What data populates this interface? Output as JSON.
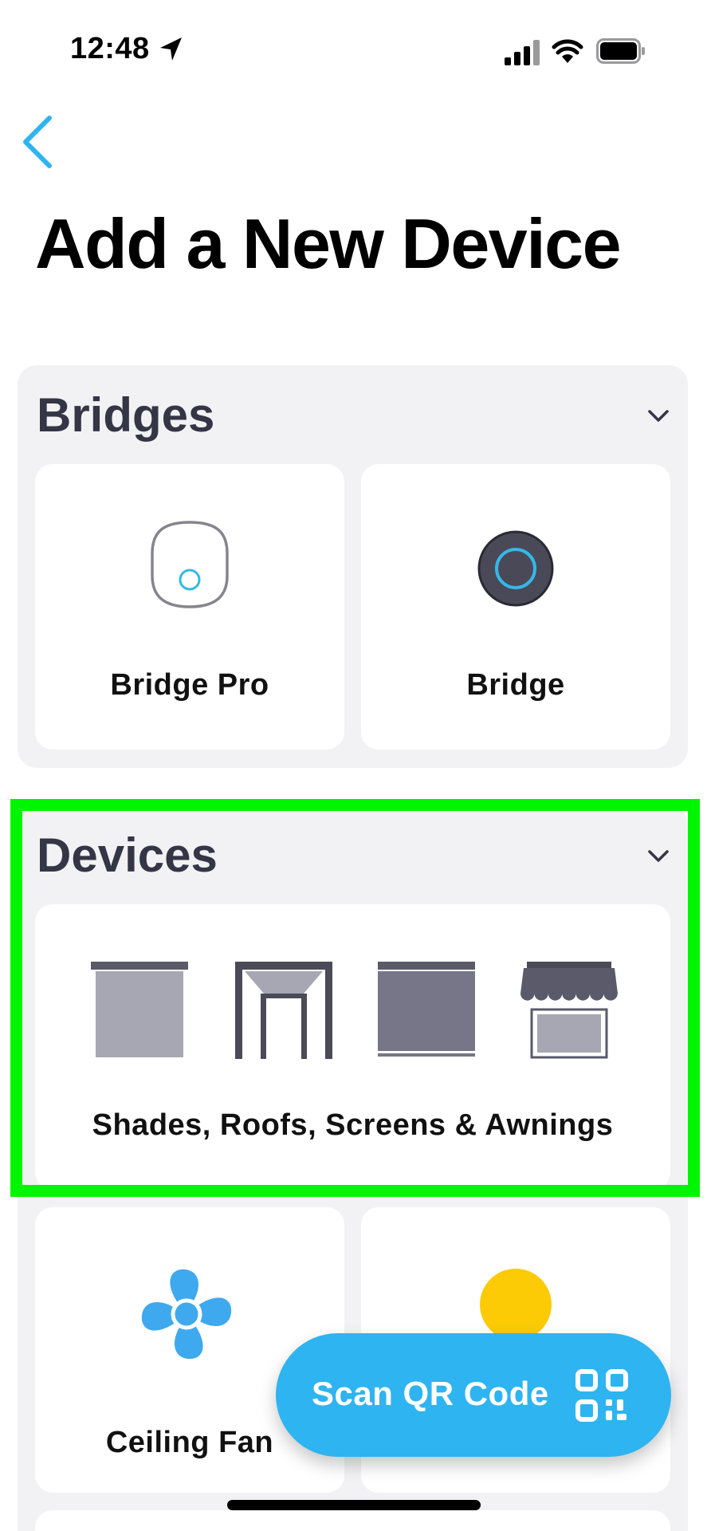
{
  "status_bar": {
    "time": "12:48"
  },
  "header": {
    "title": "Add a New Device"
  },
  "sections": [
    {
      "title": "Bridges",
      "items": [
        {
          "label": "Bridge Pro",
          "icon": "bridge-pro-icon"
        },
        {
          "label": "Bridge",
          "icon": "bridge-icon"
        }
      ]
    },
    {
      "title": "Devices",
      "items": [
        {
          "label": "Shades, Roofs, Screens & Awnings",
          "icon": "shades-roofs-screens-awnings-icons"
        },
        {
          "label": "Ceiling Fan",
          "icon": "ceiling-fan-icon"
        },
        {
          "label": "",
          "icon": "light-bulb-icon"
        }
      ]
    }
  ],
  "scan_button": {
    "label": "Scan QR Code",
    "icon": "qr-code-icon"
  },
  "colors": {
    "accent": "#2eb4f0",
    "highlight": "#00f500",
    "section_background": "#f2f2f4",
    "section_title": "#343646"
  }
}
